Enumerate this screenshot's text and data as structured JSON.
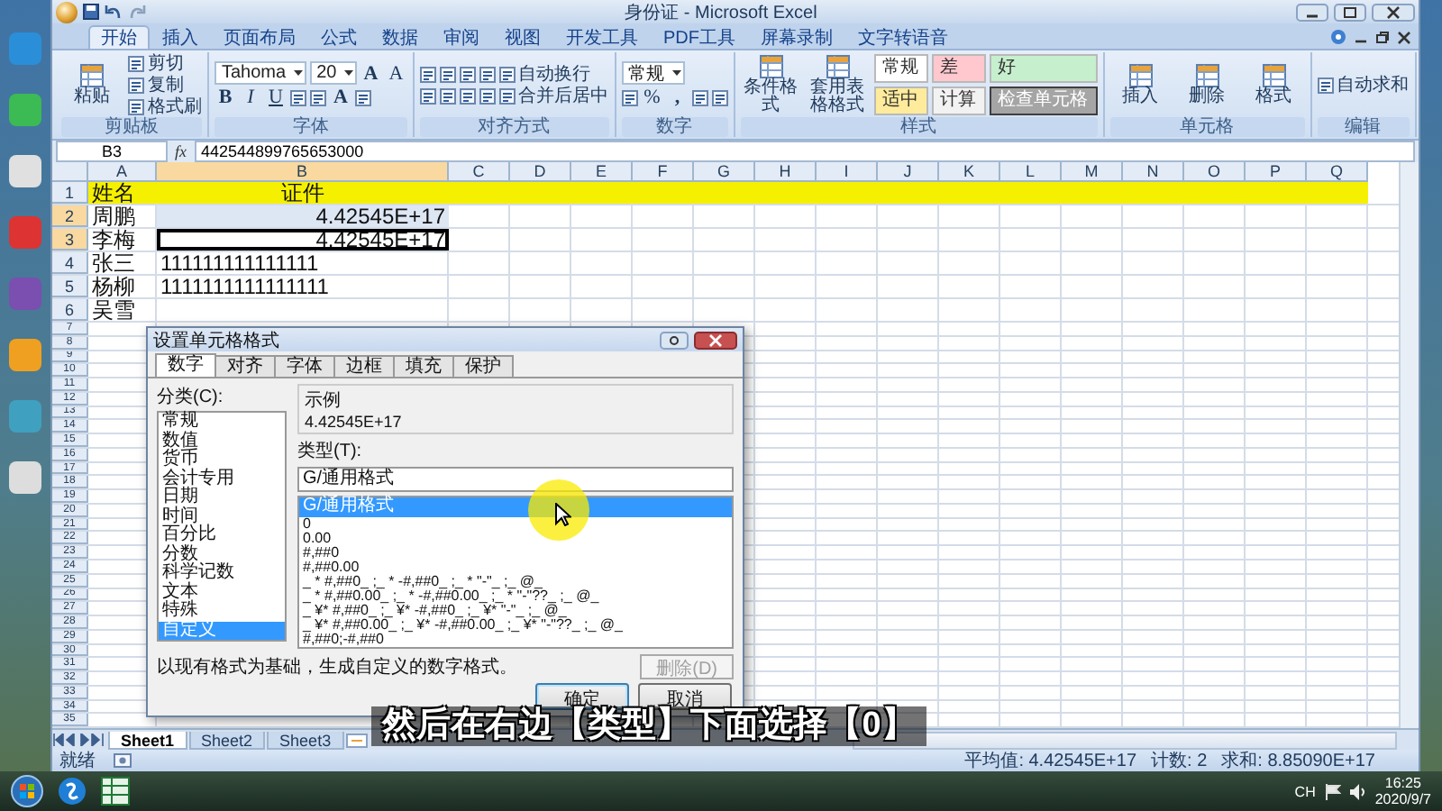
{
  "window": {
    "title": "身份证 - Microsoft Excel"
  },
  "ribbon_tabs": [
    {
      "label": "开始",
      "selected": true
    },
    {
      "label": "插入",
      "selected": false
    },
    {
      "label": "页面布局",
      "selected": false
    },
    {
      "label": "公式",
      "selected": false
    },
    {
      "label": "数据",
      "selected": false
    },
    {
      "label": "审阅",
      "selected": false
    },
    {
      "label": "视图",
      "selected": false
    },
    {
      "label": "开发工具",
      "selected": false
    },
    {
      "label": "PDF工具",
      "selected": false
    },
    {
      "label": "屏幕录制",
      "selected": false
    },
    {
      "label": "文字转语音",
      "selected": false
    }
  ],
  "ribbon": {
    "groups": [
      {
        "name": "剪贴板",
        "big": [
          {
            "kind": "big",
            "label": "粘贴"
          }
        ],
        "lines": [
          [
            {
              "kind": "small",
              "label": "剪切"
            }
          ],
          [
            {
              "kind": "small",
              "label": "复制"
            }
          ],
          [
            {
              "kind": "small",
              "label": "格式刷"
            }
          ]
        ]
      },
      {
        "name": "字体",
        "lines": [
          [
            {
              "kind": "field",
              "value": "Tahoma"
            },
            {
              "kind": "field",
              "value": "20"
            },
            {
              "kind": "bold",
              "label": "A"
            },
            {
              "kind": "glyph",
              "label": "A"
            }
          ],
          [
            {
              "kind": "bold",
              "label": "B"
            },
            {
              "kind": "italic",
              "label": "I"
            },
            {
              "kind": "underline",
              "label": "U"
            },
            {
              "kind": "icon"
            },
            {
              "kind": "icon"
            },
            {
              "kind": "bold",
              "label": "A"
            },
            {
              "kind": "icon"
            }
          ]
        ]
      },
      {
        "name": "对齐方式",
        "lines": [
          [
            {
              "kind": "icon"
            },
            {
              "kind": "icon"
            },
            {
              "kind": "icon"
            },
            {
              "kind": "icon"
            },
            {
              "kind": "small",
              "label": "自动换行"
            }
          ],
          [
            {
              "kind": "icon"
            },
            {
              "kind": "icon"
            },
            {
              "kind": "icon"
            },
            {
              "kind": "icon"
            },
            {
              "kind": "small",
              "label": "合并后居中"
            }
          ]
        ]
      },
      {
        "name": "数字",
        "lines": [
          [
            {
              "kind": "field",
              "value": "常规"
            }
          ],
          [
            {
              "kind": "icon"
            },
            {
              "kind": "glyph",
              "label": "%"
            },
            {
              "kind": "bold",
              "label": ","
            },
            {
              "kind": "icon"
            },
            {
              "kind": "icon"
            }
          ]
        ]
      },
      {
        "name": "样式",
        "big": [
          {
            "kind": "big",
            "label": "条件格式"
          },
          {
            "kind": "big",
            "label": "套用表格格式"
          }
        ],
        "styles": [
          {
            "label": "常规",
            "color": "#ffffff"
          },
          {
            "label": "差",
            "color": "#ffc7ce"
          },
          {
            "label": "好",
            "color": "#c6efce"
          },
          {
            "label": "适中",
            "color": "#ffeb9c"
          },
          {
            "label": "计算",
            "color": "#f2f2f2"
          },
          {
            "label": "检查单元格",
            "color": "#a5a5a5"
          }
        ]
      },
      {
        "name": "单元格",
        "big": [
          {
            "kind": "big",
            "label": "插入"
          },
          {
            "kind": "big",
            "label": "删除"
          },
          {
            "kind": "big",
            "label": "格式"
          }
        ]
      },
      {
        "name": "编辑",
        "lines": [
          [
            {
              "kind": "small",
              "label": "自动求和"
            }
          ]
        ]
      }
    ]
  },
  "sheet": {
    "name_box": "B3",
    "fx": "fx",
    "formula": "442544899765653000",
    "columns": [
      {
        "label": "A",
        "selected": false
      },
      {
        "label": "B",
        "selected": true
      },
      {
        "label": "C",
        "selected": false
      },
      {
        "label": "D",
        "selected": false
      },
      {
        "label": "E",
        "selected": false
      },
      {
        "label": "F",
        "selected": false
      },
      {
        "label": "G",
        "selected": false
      },
      {
        "label": "H",
        "selected": false
      },
      {
        "label": "I",
        "selected": false
      },
      {
        "label": "J",
        "selected": false
      },
      {
        "label": "K",
        "selected": false
      },
      {
        "label": "L",
        "selected": false
      },
      {
        "label": "M",
        "selected": false
      },
      {
        "label": "N",
        "selected": false
      },
      {
        "label": "O",
        "selected": false
      },
      {
        "label": "P",
        "selected": false
      },
      {
        "label": "Q",
        "selected": false
      }
    ],
    "rows": [
      {
        "number": "1",
        "kind": "header",
        "highlighted": true,
        "selected": false,
        "active": false,
        "cells": [
          "姓名",
          "证件"
        ]
      },
      {
        "number": "2",
        "kind": "number",
        "highlighted": false,
        "selected": true,
        "active": false,
        "cells": [
          "周鹏",
          "4.42545E+17"
        ]
      },
      {
        "number": "3",
        "kind": "number",
        "highlighted": false,
        "selected": true,
        "active": true,
        "cells": [
          "李梅",
          "4.42545E+17"
        ]
      },
      {
        "number": "4",
        "kind": "text",
        "highlighted": false,
        "selected": false,
        "active": false,
        "cells": [
          "张三",
          "111111111111111"
        ]
      },
      {
        "number": "5",
        "kind": "text",
        "highlighted": false,
        "selected": false,
        "active": false,
        "cells": [
          "杨柳",
          "1111111111111111"
        ]
      },
      {
        "number": "6",
        "kind": "text",
        "highlighted": false,
        "selected": false,
        "active": false,
        "cells": [
          "吴雪"
        ]
      }
    ],
    "empty_rows": [
      "7",
      "8",
      "9",
      "10",
      "11",
      "12",
      "13",
      "14",
      "15",
      "16",
      "17",
      "18",
      "19",
      "20",
      "21",
      "22",
      "23",
      "24",
      "25",
      "26",
      "27",
      "28",
      "29",
      "30",
      "31",
      "32",
      "33",
      "34",
      "35"
    ],
    "sheet_tabs": [
      {
        "label": "Sheet1",
        "selected": true
      },
      {
        "label": "Sheet2",
        "selected": false
      },
      {
        "label": "Sheet3",
        "selected": false
      }
    ],
    "status": {
      "mode": "就绪",
      "stats": [
        "平均值: 4.42545E+17",
        "计数: 2",
        "求和: 8.85090E+17"
      ]
    }
  },
  "dialog": {
    "title": "设置单元格格式",
    "tabs": [
      {
        "label": "数字",
        "selected": true
      },
      {
        "label": "对齐",
        "selected": false
      },
      {
        "label": "字体",
        "selected": false
      },
      {
        "label": "边框",
        "selected": false
      },
      {
        "label": "填充",
        "selected": false
      },
      {
        "label": "保护",
        "selected": false
      }
    ],
    "category_label": "分类(C):",
    "categories": [
      {
        "label": "常规",
        "selected": false
      },
      {
        "label": "数值",
        "selected": false
      },
      {
        "label": "货币",
        "selected": false
      },
      {
        "label": "会计专用",
        "selected": false
      },
      {
        "label": "日期",
        "selected": false
      },
      {
        "label": "时间",
        "selected": false
      },
      {
        "label": "百分比",
        "selected": false
      },
      {
        "label": "分数",
        "selected": false
      },
      {
        "label": "科学记数",
        "selected": false
      },
      {
        "label": "文本",
        "selected": false
      },
      {
        "label": "特殊",
        "selected": false
      },
      {
        "label": "自定义",
        "selected": true
      }
    ],
    "sample_label": "示例",
    "sample": "4.42545E+17",
    "type_label": "类型(T):",
    "type_value": "G/通用格式",
    "formats": [
      {
        "label": "G/通用格式",
        "kind": "name",
        "selected": true
      },
      {
        "label": "0",
        "kind": "code",
        "selected": false
      },
      {
        "label": "0.00",
        "kind": "code",
        "selected": false
      },
      {
        "label": "#,##0",
        "kind": "code",
        "selected": false
      },
      {
        "label": "#,##0.00",
        "kind": "code",
        "selected": false
      },
      {
        "label": "_ * #,##0_ ;_ * -#,##0_ ;_ * \"-\"_ ;_ @_",
        "kind": "code",
        "selected": false
      },
      {
        "label": "_ * #,##0.00_ ;_ * -#,##0.00_ ;_ * \"-\"??_ ;_ @_",
        "kind": "code",
        "selected": false
      },
      {
        "label": "_ ¥* #,##0_ ;_ ¥* -#,##0_ ;_ ¥* \"-\"_ ;_ @_",
        "kind": "code",
        "selected": false
      },
      {
        "label": "_ ¥* #,##0.00_ ;_ ¥* -#,##0.00_ ;_ ¥* \"-\"??_ ;_ @_",
        "kind": "code",
        "selected": false
      },
      {
        "label": "#,##0;-#,##0",
        "kind": "code",
        "selected": false
      }
    ],
    "delete_button": {
      "label": "删除(D)",
      "disabled": true
    },
    "description": "以现有格式为基础，生成自定义的数字格式。",
    "buttons": [
      {
        "label": "确定",
        "kind": "default"
      },
      {
        "label": "取消",
        "kind": "normal"
      }
    ]
  },
  "subtitle": "然后在右边【类型】下面选择【0】",
  "taskbar": {
    "language": "CH",
    "time": "16:25",
    "date": "2020/9/7"
  }
}
